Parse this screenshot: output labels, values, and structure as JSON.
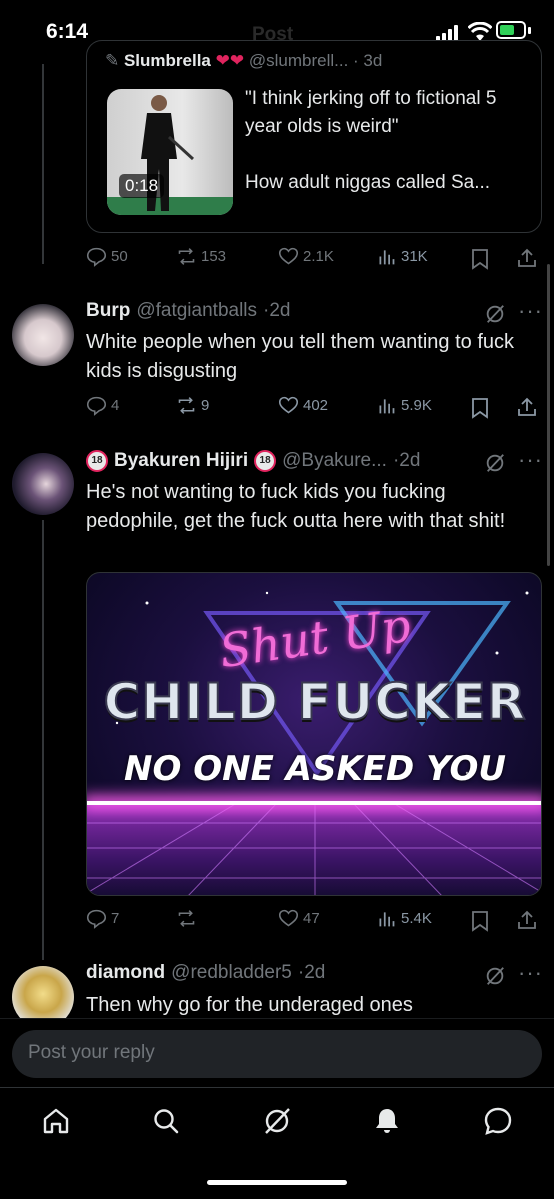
{
  "status": {
    "time": "6:14",
    "ghost_title": "Post"
  },
  "quote": {
    "author_name": "Slumbrella",
    "author_handle": "@slumbrell...",
    "author_time": "3d",
    "video_duration": "0:18",
    "text": "\"I think jerking off to fictional 5 year olds is weird\"\n\nHow adult niggas called Sa...",
    "actions": {
      "replies": "50",
      "reposts": "153",
      "likes": "2.1K",
      "views": "31K"
    }
  },
  "posts": [
    {
      "name": "Burp",
      "handle": "@fatgiantballs",
      "time": "2d",
      "body": "White people when you tell them wanting to fuck kids is disgusting",
      "actions": {
        "replies": "4",
        "reposts": "9",
        "likes": "402",
        "views": "5.9K"
      }
    },
    {
      "name": "Byakuren Hijiri",
      "handle": "@Byakure...",
      "time": "2d",
      "badge": "18",
      "body": "He's not wanting to fuck kids you fucking pedophile, get the fuck outta here with that shit!",
      "media": {
        "line1": "Shut Up",
        "line2": "CHILD FUCKER",
        "line3": "NO ONE ASKED YOU"
      },
      "actions": {
        "replies": "7",
        "reposts": "",
        "likes": "47",
        "views": "5.4K"
      }
    },
    {
      "name": "diamond",
      "handle": "@redbladder5",
      "time": "2d",
      "body": "Then why go for the underaged ones"
    }
  ],
  "reply": {
    "placeholder": "Post your reply"
  },
  "tabs": [
    "home-icon",
    "search-icon",
    "grok-icon",
    "notifications-icon",
    "messages-icon"
  ],
  "colors": {
    "background": "#000000",
    "muted": "#71767b",
    "text": "#e7e9ea",
    "reply_bg": "#202327"
  }
}
